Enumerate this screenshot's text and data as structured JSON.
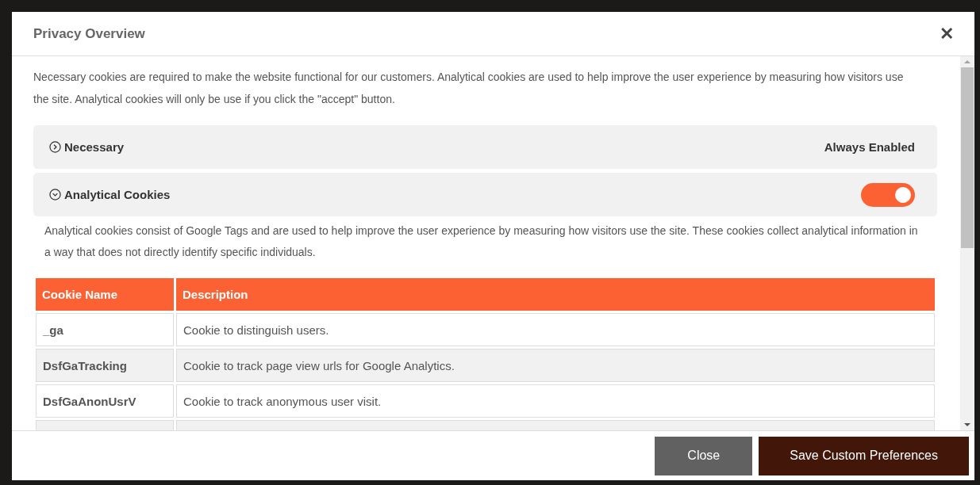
{
  "dialog": {
    "title": "Privacy Overview",
    "close_icon": "✕"
  },
  "intro": "Necessary cookies are required to make the website functional for our customers. Analytical cookies are used to help improve the user experience by measuring how visitors use the site. Analytical cookies will only be use if you click the \"accept\" button.",
  "sections": [
    {
      "kind": "status",
      "label": "Necessary",
      "expanded": false,
      "status": "Always Enabled"
    },
    {
      "kind": "toggle",
      "label": "Analytical Cookies",
      "expanded": true,
      "on": true,
      "description": "Analytical cookies consist of Google Tags and are used to help improve the user experience by measuring how visitors use the site. These cookies collect analytical information in a way that does not directly identify specific individuals.",
      "table": {
        "columns": [
          "Cookie Name",
          "Description"
        ],
        "rows": [
          [
            "_ga",
            "Cookie to distinguish users."
          ],
          [
            "DsfGaTracking",
            "Cookie to track page view urls for Google Analytics."
          ],
          [
            "DsfGaAnonUsrV",
            "Cookie to track anonymous user visit."
          ]
        ]
      }
    }
  ],
  "buttons": [
    {
      "kind": "secondary",
      "label": "Close"
    },
    {
      "kind": "primary",
      "label": "Save Custom Preferences"
    }
  ]
}
